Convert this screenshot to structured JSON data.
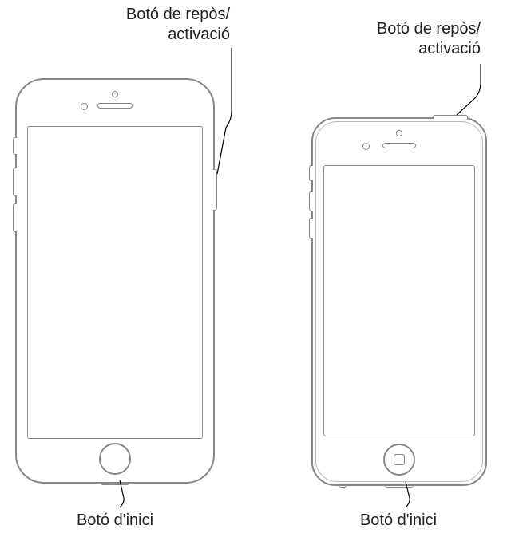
{
  "labels": {
    "left_sleep_wake_line1": "Botó de repòs/",
    "left_sleep_wake_line2": "activació",
    "right_sleep_wake_line1": "Botó de repòs/",
    "right_sleep_wake_line2": "activació",
    "left_home": "Botó d'inici",
    "right_home": "Botó d'inici"
  }
}
